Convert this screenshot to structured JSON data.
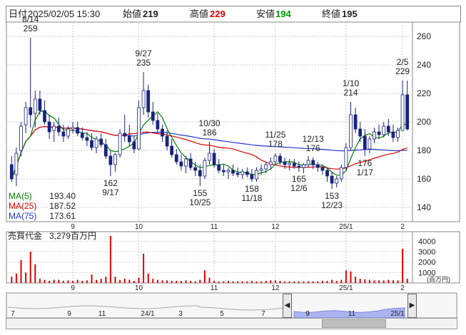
{
  "header": {
    "date_label": "日付",
    "date_value": "2025/02/05 15:30",
    "open_label": "始値",
    "open_value": "219",
    "high_label": "高値",
    "high_value": "229",
    "low_label": "安値",
    "low_value": "194",
    "close_label": "終値",
    "close_value": "195"
  },
  "colors": {
    "candle_up": "#ffffff",
    "candle_down": "#1a237e",
    "ma5": "#008000",
    "ma25": "#e00000",
    "ma75": "#2233cc",
    "volume": "#e00000",
    "nav_fill": "#aab4f0"
  },
  "legend": [
    {
      "name": "MA(5)",
      "value": "193.40",
      "color": "#008000"
    },
    {
      "name": "MA(25)",
      "value": "187.52",
      "color": "#e00000"
    },
    {
      "name": "MA(75)",
      "value": "173.61",
      "color": "#2233cc"
    }
  ],
  "annotations": [
    {
      "date": "8/14",
      "value": "259"
    },
    {
      "date": "9/27",
      "value": "235"
    },
    {
      "date": "9/17",
      "value": "162"
    },
    {
      "date": "10/30",
      "value": "186"
    },
    {
      "date": "10/25",
      "value": "155"
    },
    {
      "date": "11/25",
      "value": "178"
    },
    {
      "date": "11/18",
      "value": "158"
    },
    {
      "date": "12/13",
      "value": "176"
    },
    {
      "date": "12/6",
      "value": "165"
    },
    {
      "date": "12/23",
      "value": "153"
    },
    {
      "date": "1/10",
      "value": "214"
    },
    {
      "date": "1/17",
      "value": "176"
    },
    {
      "date": "2/5",
      "value": "229"
    }
  ],
  "volume_panel": {
    "title": "売買代金",
    "value_text": "3,279百万円",
    "unit": "(百万円)",
    "y_ticks": [
      "4000",
      "3000",
      "2000",
      "1000"
    ]
  },
  "nav": {
    "labels": [
      "7",
      "9",
      "11",
      "24/1",
      "3",
      "5",
      "7",
      "9",
      "11",
      "25/1"
    ],
    "left_arrow": "◀",
    "right_arrow": "▶"
  },
  "chart_data": [
    {
      "type": "candlestick",
      "x_tick_labels": [
        "9",
        "10",
        "11",
        "12",
        "25/1",
        "2"
      ],
      "y_ticks": [
        140,
        160,
        180,
        200,
        220,
        240,
        260
      ],
      "ylim": [
        130,
        270
      ],
      "grid": true,
      "ohlc": [
        [
          170,
          176,
          158,
          160
        ],
        [
          163,
          182,
          155,
          178
        ],
        [
          180,
          200,
          176,
          197
        ],
        [
          198,
          214,
          192,
          210
        ],
        [
          210,
          259,
          196,
          205
        ],
        [
          206,
          222,
          196,
          216
        ],
        [
          216,
          222,
          205,
          208
        ],
        [
          208,
          215,
          198,
          200
        ],
        [
          200,
          205,
          188,
          193
        ],
        [
          194,
          200,
          186,
          197
        ],
        [
          197,
          203,
          190,
          193
        ],
        [
          193,
          198,
          186,
          190
        ],
        [
          190,
          197,
          188,
          195
        ],
        [
          195,
          200,
          192,
          196
        ],
        [
          196,
          200,
          190,
          192
        ],
        [
          192,
          196,
          187,
          189
        ],
        [
          189,
          193,
          183,
          187
        ],
        [
          187,
          192,
          180,
          182
        ],
        [
          182,
          190,
          178,
          188
        ],
        [
          188,
          192,
          182,
          184
        ],
        [
          184,
          188,
          174,
          176
        ],
        [
          176,
          180,
          162,
          170
        ],
        [
          170,
          178,
          165,
          177
        ],
        [
          177,
          195,
          175,
          192
        ],
        [
          192,
          205,
          186,
          190
        ],
        [
          190,
          198,
          183,
          186
        ],
        [
          186,
          190,
          178,
          181
        ],
        [
          181,
          215,
          180,
          210
        ],
        [
          210,
          235,
          205,
          222
        ],
        [
          222,
          226,
          203,
          207
        ],
        [
          207,
          214,
          198,
          201
        ],
        [
          201,
          206,
          192,
          195
        ],
        [
          195,
          198,
          186,
          190
        ],
        [
          190,
          194,
          180,
          183
        ],
        [
          183,
          188,
          175,
          177
        ],
        [
          177,
          181,
          170,
          172
        ],
        [
          172,
          177,
          166,
          169
        ],
        [
          169,
          176,
          164,
          174
        ],
        [
          174,
          178,
          166,
          168
        ],
        [
          168,
          172,
          162,
          166
        ],
        [
          166,
          170,
          155,
          162
        ],
        [
          162,
          175,
          160,
          173
        ],
        [
          173,
          186,
          170,
          178
        ],
        [
          178,
          181,
          168,
          170
        ],
        [
          170,
          174,
          164,
          166
        ],
        [
          166,
          170,
          162,
          165
        ],
        [
          165,
          168,
          160,
          166
        ],
        [
          166,
          170,
          162,
          164
        ],
        [
          164,
          168,
          161,
          163
        ],
        [
          163,
          167,
          160,
          165
        ],
        [
          165,
          168,
          161,
          163
        ],
        [
          163,
          167,
          158,
          160
        ],
        [
          160,
          168,
          158,
          166
        ],
        [
          166,
          170,
          163,
          167
        ],
        [
          167,
          172,
          164,
          170
        ],
        [
          170,
          175,
          167,
          172
        ],
        [
          172,
          178,
          170,
          176
        ],
        [
          176,
          178,
          170,
          172
        ],
        [
          172,
          175,
          167,
          170
        ],
        [
          170,
          174,
          166,
          171
        ],
        [
          171,
          174,
          167,
          169
        ],
        [
          169,
          172,
          165,
          168
        ],
        [
          168,
          171,
          164,
          170
        ],
        [
          170,
          176,
          168,
          173
        ],
        [
          173,
          175,
          167,
          170
        ],
        [
          170,
          172,
          165,
          168
        ],
        [
          168,
          170,
          163,
          166
        ],
        [
          166,
          168,
          158,
          162
        ],
        [
          162,
          165,
          153,
          157
        ],
        [
          157,
          162,
          154,
          160
        ],
        [
          160,
          170,
          158,
          168
        ],
        [
          168,
          185,
          166,
          182
        ],
        [
          182,
          214,
          180,
          205
        ],
        [
          205,
          210,
          192,
          195
        ],
        [
          195,
          200,
          186,
          190
        ],
        [
          190,
          195,
          176,
          181
        ],
        [
          181,
          190,
          178,
          188
        ],
        [
          188,
          196,
          185,
          193
        ],
        [
          193,
          198,
          188,
          191
        ],
        [
          191,
          200,
          189,
          197
        ],
        [
          197,
          202,
          190,
          193
        ],
        [
          193,
          198,
          186,
          189
        ],
        [
          189,
          196,
          186,
          194
        ],
        [
          194,
          229,
          194,
          219
        ],
        [
          219,
          229,
          194,
          195
        ]
      ],
      "volume": [
        600,
        900,
        2200,
        1000,
        3000,
        1800,
        400,
        300,
        200,
        300,
        300,
        200,
        250,
        200,
        300,
        200,
        250,
        800,
        300,
        400,
        600,
        4500,
        600,
        300,
        400,
        300,
        200,
        500,
        2800,
        900,
        400,
        300,
        250,
        250,
        200,
        200,
        200,
        250,
        200,
        150,
        300,
        1200,
        500,
        200,
        150,
        150,
        200,
        150,
        150,
        150,
        150,
        200,
        150,
        150,
        200,
        250,
        250,
        200,
        150,
        150,
        150,
        150,
        150,
        150,
        150,
        150,
        200,
        200,
        300,
        200,
        300,
        1200,
        1100,
        600,
        400,
        350,
        300,
        250,
        250,
        250,
        300,
        250,
        250,
        3279,
        400
      ],
      "x_ticks_at_index": [
        13,
        27,
        43,
        56,
        71,
        83
      ]
    }
  ]
}
